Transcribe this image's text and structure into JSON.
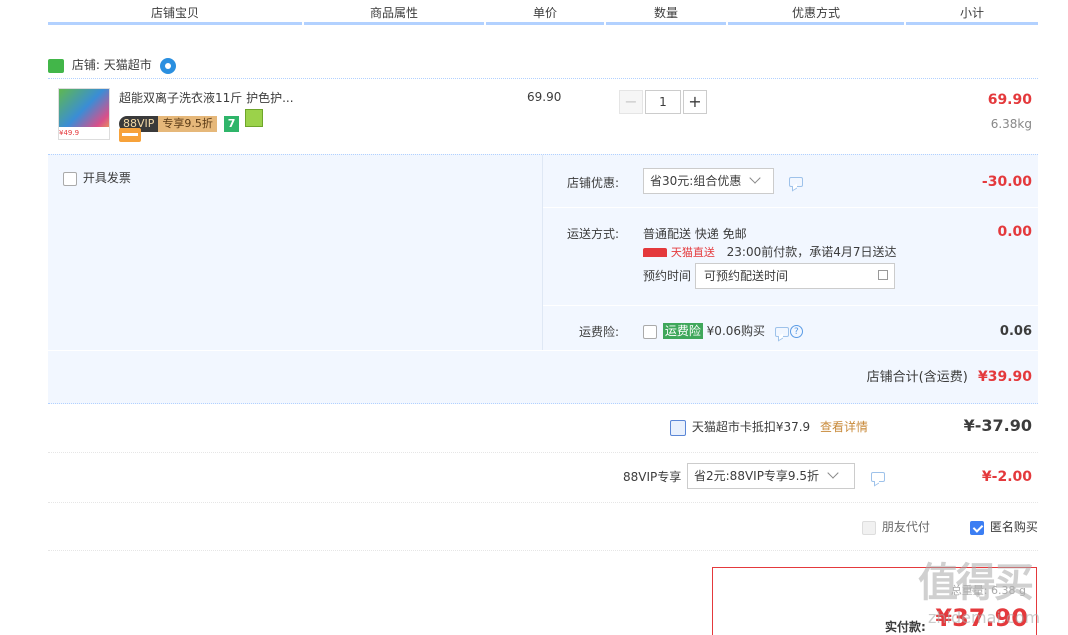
{
  "header": {
    "columns": [
      "店铺宝贝",
      "商品属性",
      "单价",
      "数量",
      "优惠方式",
      "小计"
    ]
  },
  "store": {
    "label": "店铺:",
    "name": "天猫超市"
  },
  "item": {
    "title": "超能双离子洗衣液11斤 护色护...",
    "badge_88vip": "88VIP",
    "badge_discount": "专享9.5折",
    "badge_7": "7",
    "unit_price": "69.90",
    "quantity": "1",
    "minus": "−",
    "plus": "+",
    "subtotal": "69.90",
    "weight": "6.38kg",
    "thumb_price_label": "¥49.9"
  },
  "invoice": {
    "label": "开具发票"
  },
  "store_discount": {
    "label": "店铺优惠:",
    "select_value": "省30元:组合优惠",
    "amount": "-30.00"
  },
  "shipping": {
    "label": "运送方式:",
    "method": "普通配送 快递 免邮",
    "brand": "天猫直送",
    "promise": "23:00前付款，承诺4月7日送达",
    "reserve_label": "预约时间",
    "reserve_placeholder": "可预约配送时间",
    "amount": "0.00"
  },
  "insurance": {
    "label": "运费险:",
    "tag": "运费险",
    "price_text": "¥0.06购买",
    "help": "?",
    "amount": "0.06"
  },
  "store_total": {
    "label": "店铺合计(含运费)",
    "amount": "¥39.90"
  },
  "card_deduct": {
    "label": "天猫超市卡抵扣¥37.9",
    "link": "查看详情",
    "amount": "¥-37.90"
  },
  "vip": {
    "label": "88VIP专享",
    "select_value": "省2元:88VIP专享9.5折",
    "amount": "¥-2.00"
  },
  "options": {
    "friend_pay": "朋友代付",
    "anonymous": "匿名购买"
  },
  "pay": {
    "weight_label": "总重量: 6.38 g",
    "label": "实付款:",
    "amount": "¥37.90"
  },
  "watermark": {
    "text": "值得买",
    "domain": "zhidemai.com"
  },
  "colors": {
    "accent_red": "#e4393c",
    "header_blue": "#b2d1ff",
    "panel_bg": "#f2f7ff",
    "tmall_green": "#42b649"
  }
}
